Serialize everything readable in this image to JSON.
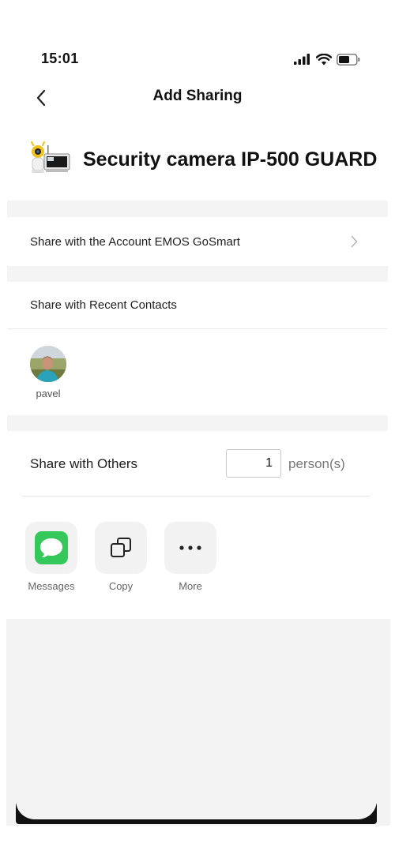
{
  "status_bar": {
    "time": "15:01"
  },
  "nav": {
    "title": "Add Sharing"
  },
  "device": {
    "name": "Security camera IP-500 GUARD"
  },
  "share_account": {
    "label": "Share with the Account EMOS GoSmart"
  },
  "recent_contacts": {
    "label": "Share with Recent Contacts",
    "contacts": [
      {
        "name": "pavel"
      }
    ]
  },
  "share_others": {
    "label": "Share with Others",
    "count": "1",
    "unit": "person(s)"
  },
  "share_options": [
    {
      "label": "Messages",
      "icon": "messages-icon"
    },
    {
      "label": "Copy",
      "icon": "copy-icon"
    },
    {
      "label": "More",
      "icon": "more-icon"
    }
  ],
  "colors": {
    "messages_green": "#34c759",
    "section_gap": "#f4f4f5"
  }
}
